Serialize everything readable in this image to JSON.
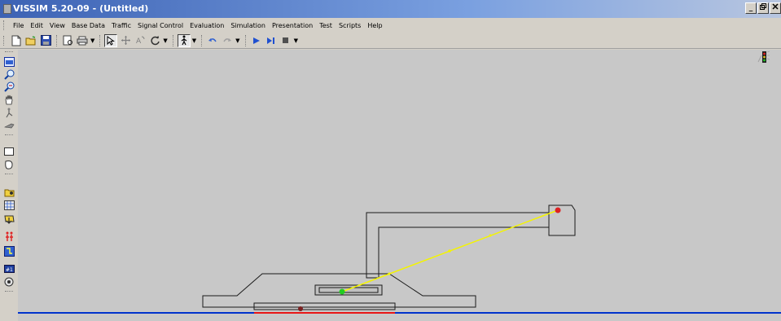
{
  "window": {
    "title": "VISSIM 5.20-09 - (Untitled)",
    "controls": [
      "_",
      " ",
      " "
    ]
  },
  "menu": [
    {
      "label": "File",
      "key": "file"
    },
    {
      "label": "Edit",
      "key": "edit"
    },
    {
      "label": "View",
      "key": "view"
    },
    {
      "label": "Base Data",
      "key": "base-data"
    },
    {
      "label": "Traffic",
      "key": "traffic"
    },
    {
      "label": "Signal Control",
      "key": "signal-control"
    },
    {
      "label": "Evaluation",
      "key": "evaluation"
    },
    {
      "label": "Simulation",
      "key": "simulation"
    },
    {
      "label": "Presentation",
      "key": "presentation"
    },
    {
      "label": "Test",
      "key": "test"
    },
    {
      "label": "Scripts",
      "key": "scripts"
    },
    {
      "label": "Help",
      "key": "help"
    }
  ],
  "toolbar": [
    "new-file-icon",
    "open-folder-icon",
    "save-icon",
    "print-preview-icon",
    "print-icon",
    "select-arrow-icon",
    "move-icon",
    "rotate-icon",
    "refresh-icon",
    "pedestrian-icon",
    "undo-icon",
    "redo-icon",
    "play-icon",
    "step-icon",
    "stop-icon"
  ],
  "left_toolbar": [
    "network-view-icon",
    "zoom-in-icon",
    "zoom-out-icon",
    "pan-hand-icon",
    "link-tool-icon",
    "connector-tool-icon",
    "rectangle-tool-icon",
    "area-tool-icon",
    "folder-tool-icon",
    "grid-tool-icon",
    "vehicle-input-icon",
    "pedestrian-tool-icon",
    "routes-tool-icon",
    "counter-tool-icon",
    "sensor-tool-icon"
  ],
  "colors": {
    "canvas_bg": "#c8c8c8",
    "road_line": "#1a1a1a",
    "route": "#f4f400",
    "start_point": "#22cc22",
    "end_point": "#dd2222",
    "baseline": "#0033cc",
    "link_red": "#e81818"
  }
}
